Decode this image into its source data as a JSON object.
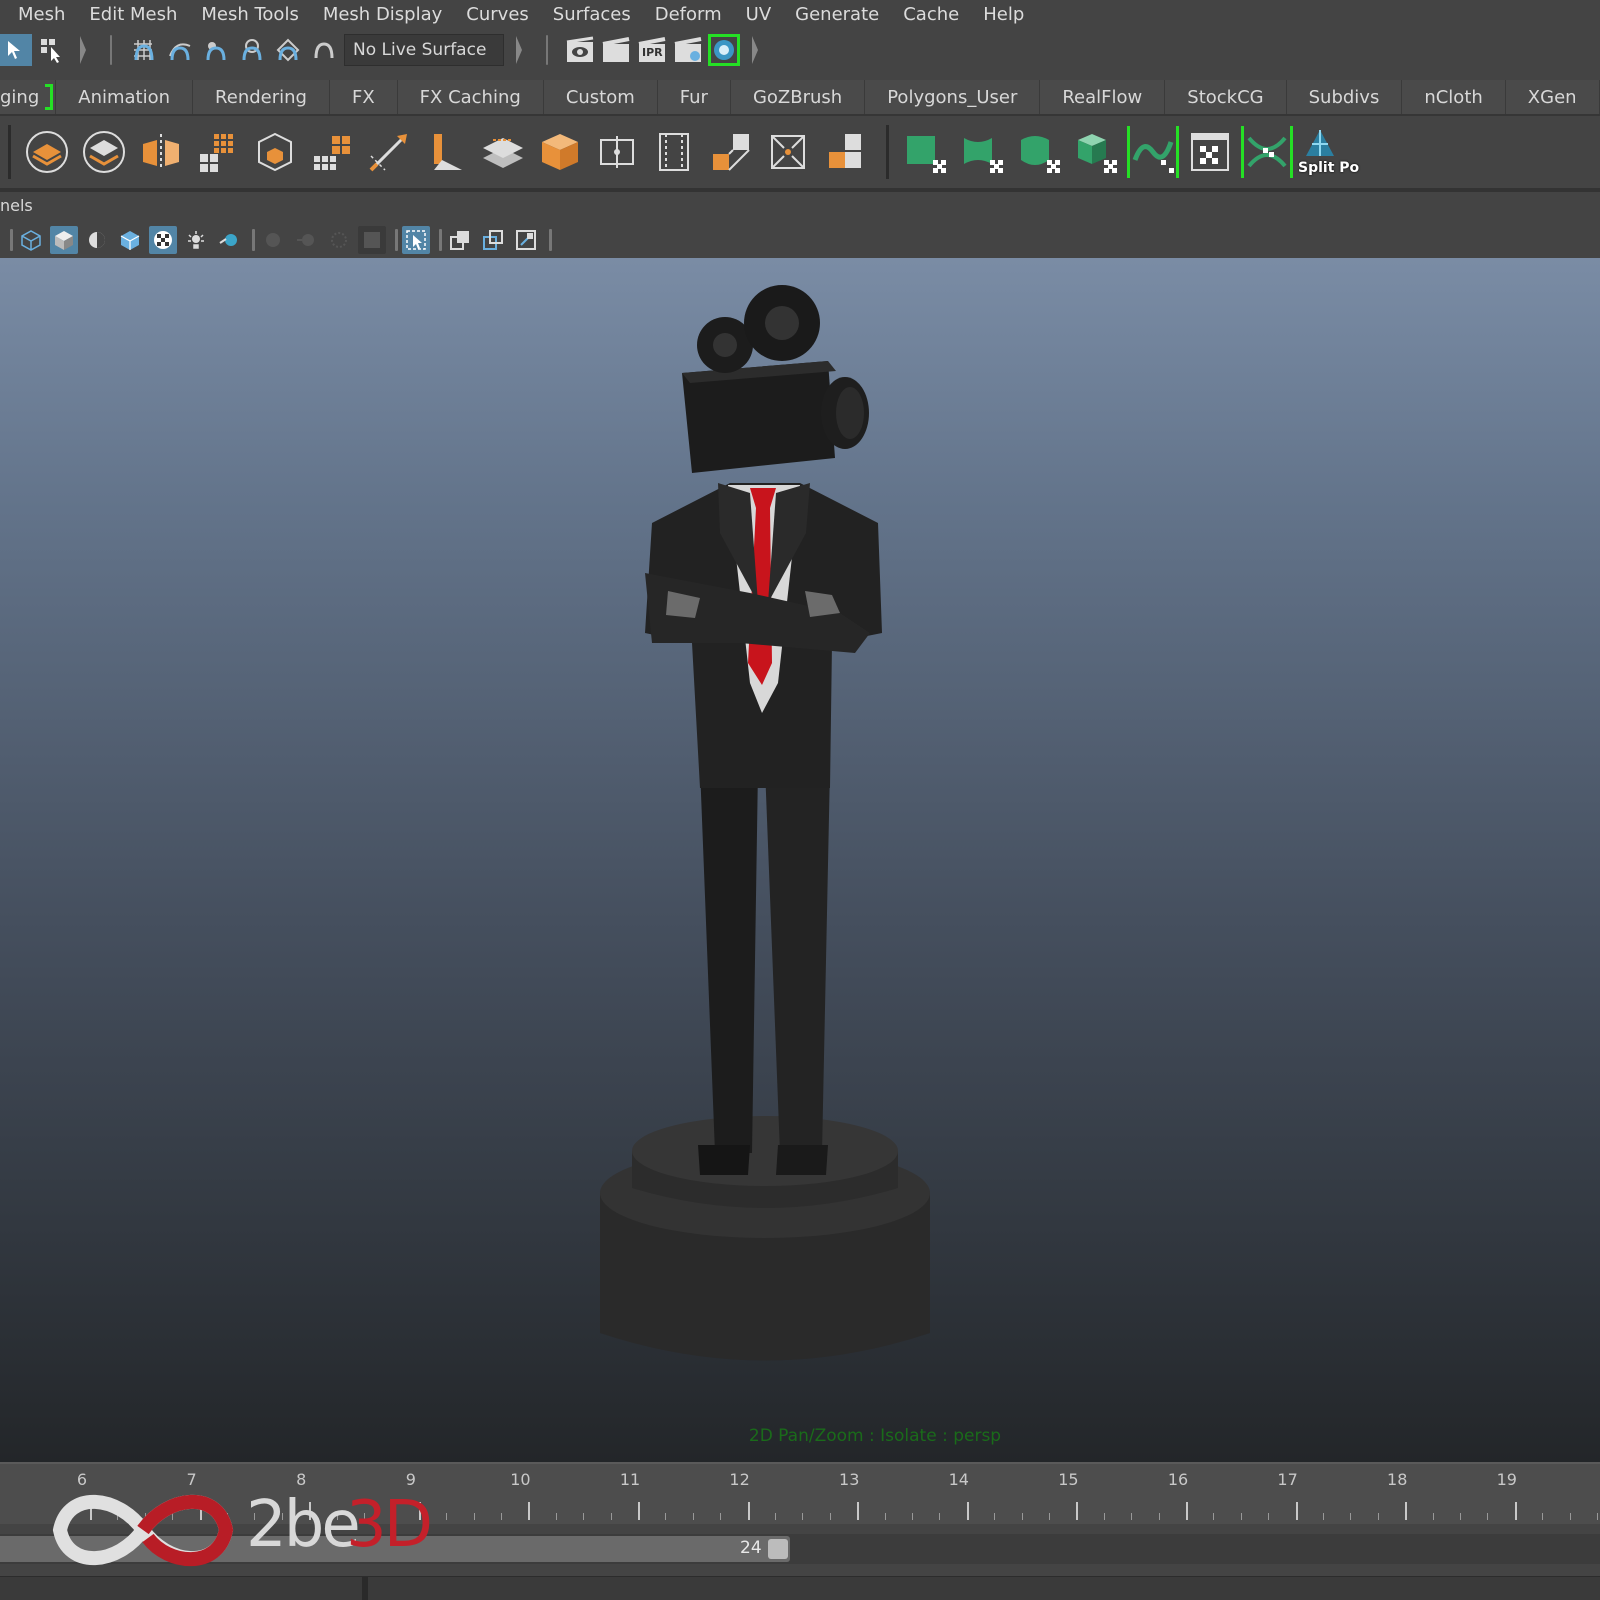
{
  "menu": [
    "Mesh",
    "Edit Mesh",
    "Mesh Tools",
    "Mesh Display",
    "Curves",
    "Surfaces",
    "Deform",
    "UV",
    "Generate",
    "Cache",
    "Help"
  ],
  "status_line": {
    "live_surface": "No Live Surface",
    "render_ipr_label": "IPR"
  },
  "shelf_tabs": [
    "ging",
    "Animation",
    "Rendering",
    "FX",
    "FX Caching",
    "Custom",
    "Fur",
    "GoZBrush",
    "Polygons_User",
    "RealFlow",
    "StockCG",
    "Subdivs",
    "nCloth",
    "XGen"
  ],
  "shelf": {
    "last_label": "Split Po"
  },
  "panels_label": "nels",
  "hud": "2D Pan/Zoom : Isolate : persp",
  "timeline": {
    "ticks": [
      "6",
      "7",
      "8",
      "9",
      "10",
      "11",
      "12",
      "13",
      "14",
      "15",
      "16",
      "17",
      "18",
      "19"
    ]
  },
  "range": {
    "end_value": "24"
  },
  "watermark": {
    "text_part1": "2be",
    "text_part2": "3D"
  },
  "colors": {
    "accent_green": "#25e025",
    "brand_red": "#c4202a",
    "highlight_blue": "#5285a6"
  }
}
